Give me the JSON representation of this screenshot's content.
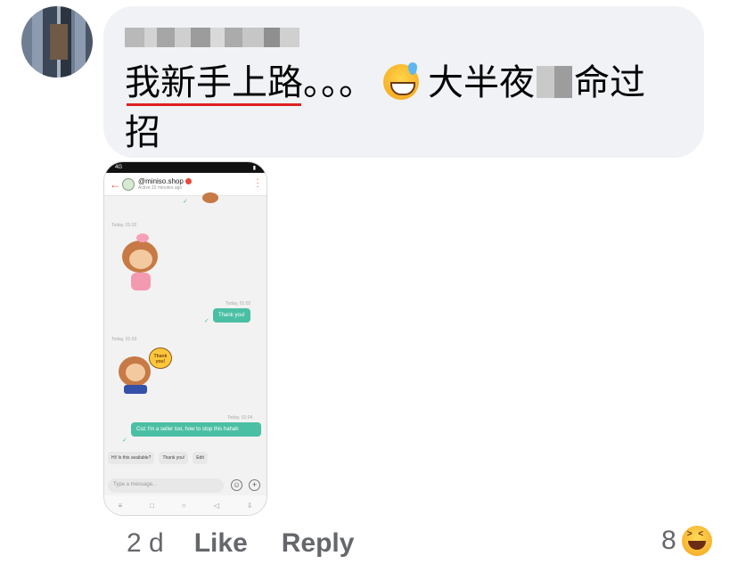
{
  "comment": {
    "author_name_redacted": true,
    "text_underlined": "我新手上路",
    "text_dots": "。。。",
    "emoji": "grinning-sweat-emoji",
    "text_after_emoji": "大半夜",
    "text_end": "命过",
    "text_line2": "招",
    "bubble_color": "#f0f2f5",
    "underline_color": "#e02020"
  },
  "attachment": {
    "status_bar_left": "4G",
    "status_bar_right": "▮",
    "shop_name": "@miniso.shop",
    "shop_status": "Active 15 minutes ago",
    "timestamps": [
      "Today, 01:02",
      "Today, 01:02",
      "Today, 01:03",
      "Today, 01:04"
    ],
    "messages": [
      "Thank you!",
      "Coz I'm a seller too, how to stop this hahah"
    ],
    "sticker_text": "Thank you!",
    "quick_replies": [
      "Hi! Is this available?",
      "Thank you!",
      "Edit"
    ],
    "input_placeholder": "Type a message...",
    "accent_color": "#4bbfa4",
    "brand_color": "#e64a3c"
  },
  "actions": {
    "time": "2 d",
    "like": "Like",
    "reply": "Reply",
    "reaction_count": "8",
    "reaction_emoji": "laughing-emoji"
  }
}
